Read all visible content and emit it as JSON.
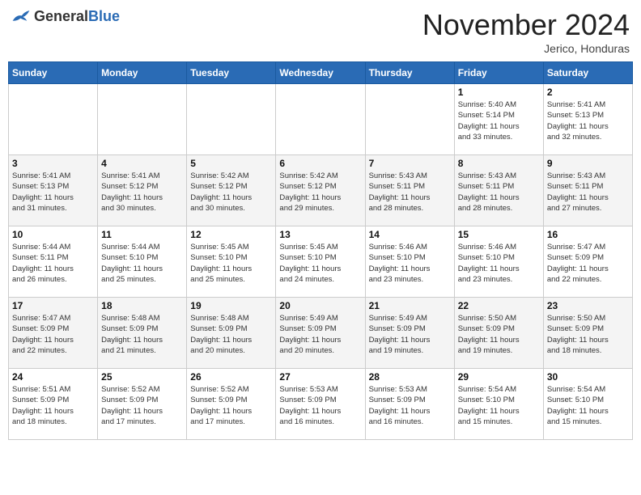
{
  "header": {
    "logo_general": "General",
    "logo_blue": "Blue",
    "month_year": "November 2024",
    "location": "Jerico, Honduras"
  },
  "days_of_week": [
    "Sunday",
    "Monday",
    "Tuesday",
    "Wednesday",
    "Thursday",
    "Friday",
    "Saturday"
  ],
  "weeks": [
    [
      {
        "day": "",
        "info": ""
      },
      {
        "day": "",
        "info": ""
      },
      {
        "day": "",
        "info": ""
      },
      {
        "day": "",
        "info": ""
      },
      {
        "day": "",
        "info": ""
      },
      {
        "day": "1",
        "info": "Sunrise: 5:40 AM\nSunset: 5:14 PM\nDaylight: 11 hours\nand 33 minutes."
      },
      {
        "day": "2",
        "info": "Sunrise: 5:41 AM\nSunset: 5:13 PM\nDaylight: 11 hours\nand 32 minutes."
      }
    ],
    [
      {
        "day": "3",
        "info": "Sunrise: 5:41 AM\nSunset: 5:13 PM\nDaylight: 11 hours\nand 31 minutes."
      },
      {
        "day": "4",
        "info": "Sunrise: 5:41 AM\nSunset: 5:12 PM\nDaylight: 11 hours\nand 30 minutes."
      },
      {
        "day": "5",
        "info": "Sunrise: 5:42 AM\nSunset: 5:12 PM\nDaylight: 11 hours\nand 30 minutes."
      },
      {
        "day": "6",
        "info": "Sunrise: 5:42 AM\nSunset: 5:12 PM\nDaylight: 11 hours\nand 29 minutes."
      },
      {
        "day": "7",
        "info": "Sunrise: 5:43 AM\nSunset: 5:11 PM\nDaylight: 11 hours\nand 28 minutes."
      },
      {
        "day": "8",
        "info": "Sunrise: 5:43 AM\nSunset: 5:11 PM\nDaylight: 11 hours\nand 28 minutes."
      },
      {
        "day": "9",
        "info": "Sunrise: 5:43 AM\nSunset: 5:11 PM\nDaylight: 11 hours\nand 27 minutes."
      }
    ],
    [
      {
        "day": "10",
        "info": "Sunrise: 5:44 AM\nSunset: 5:11 PM\nDaylight: 11 hours\nand 26 minutes."
      },
      {
        "day": "11",
        "info": "Sunrise: 5:44 AM\nSunset: 5:10 PM\nDaylight: 11 hours\nand 25 minutes."
      },
      {
        "day": "12",
        "info": "Sunrise: 5:45 AM\nSunset: 5:10 PM\nDaylight: 11 hours\nand 25 minutes."
      },
      {
        "day": "13",
        "info": "Sunrise: 5:45 AM\nSunset: 5:10 PM\nDaylight: 11 hours\nand 24 minutes."
      },
      {
        "day": "14",
        "info": "Sunrise: 5:46 AM\nSunset: 5:10 PM\nDaylight: 11 hours\nand 23 minutes."
      },
      {
        "day": "15",
        "info": "Sunrise: 5:46 AM\nSunset: 5:10 PM\nDaylight: 11 hours\nand 23 minutes."
      },
      {
        "day": "16",
        "info": "Sunrise: 5:47 AM\nSunset: 5:09 PM\nDaylight: 11 hours\nand 22 minutes."
      }
    ],
    [
      {
        "day": "17",
        "info": "Sunrise: 5:47 AM\nSunset: 5:09 PM\nDaylight: 11 hours\nand 22 minutes."
      },
      {
        "day": "18",
        "info": "Sunrise: 5:48 AM\nSunset: 5:09 PM\nDaylight: 11 hours\nand 21 minutes."
      },
      {
        "day": "19",
        "info": "Sunrise: 5:48 AM\nSunset: 5:09 PM\nDaylight: 11 hours\nand 20 minutes."
      },
      {
        "day": "20",
        "info": "Sunrise: 5:49 AM\nSunset: 5:09 PM\nDaylight: 11 hours\nand 20 minutes."
      },
      {
        "day": "21",
        "info": "Sunrise: 5:49 AM\nSunset: 5:09 PM\nDaylight: 11 hours\nand 19 minutes."
      },
      {
        "day": "22",
        "info": "Sunrise: 5:50 AM\nSunset: 5:09 PM\nDaylight: 11 hours\nand 19 minutes."
      },
      {
        "day": "23",
        "info": "Sunrise: 5:50 AM\nSunset: 5:09 PM\nDaylight: 11 hours\nand 18 minutes."
      }
    ],
    [
      {
        "day": "24",
        "info": "Sunrise: 5:51 AM\nSunset: 5:09 PM\nDaylight: 11 hours\nand 18 minutes."
      },
      {
        "day": "25",
        "info": "Sunrise: 5:52 AM\nSunset: 5:09 PM\nDaylight: 11 hours\nand 17 minutes."
      },
      {
        "day": "26",
        "info": "Sunrise: 5:52 AM\nSunset: 5:09 PM\nDaylight: 11 hours\nand 17 minutes."
      },
      {
        "day": "27",
        "info": "Sunrise: 5:53 AM\nSunset: 5:09 PM\nDaylight: 11 hours\nand 16 minutes."
      },
      {
        "day": "28",
        "info": "Sunrise: 5:53 AM\nSunset: 5:09 PM\nDaylight: 11 hours\nand 16 minutes."
      },
      {
        "day": "29",
        "info": "Sunrise: 5:54 AM\nSunset: 5:10 PM\nDaylight: 11 hours\nand 15 minutes."
      },
      {
        "day": "30",
        "info": "Sunrise: 5:54 AM\nSunset: 5:10 PM\nDaylight: 11 hours\nand 15 minutes."
      }
    ]
  ]
}
